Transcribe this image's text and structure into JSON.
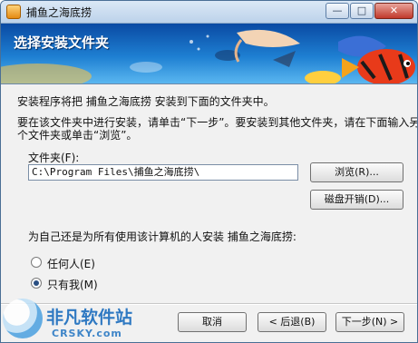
{
  "window": {
    "title": "捕鱼之海底捞",
    "min_glyph": "—",
    "max_glyph": "□",
    "close_glyph": "✕"
  },
  "banner": {
    "title": "选择安装文件夹"
  },
  "main": {
    "intro": "安装程序将把 捕鱼之海底捞 安装到下面的文件夹中。",
    "instructions_line1": "要在该文件夹中进行安装，请单击“下一步”。要安装到其他文件夹，请在下面输入另一",
    "instructions_line2": "个文件夹或单击“浏览”。",
    "folder_label": "文件夹(F):",
    "folder_value": "C:\\Program Files\\捕鱼之海底捞\\",
    "browse_button": "浏览(R)...",
    "disk_cost_button": "磁盘开销(D)...",
    "install_for_question": "为自己还是为所有使用该计算机的人安装 捕鱼之海底捞:",
    "radio_options": [
      {
        "label": "任何人(E)",
        "checked": false
      },
      {
        "label": "只有我(M)",
        "checked": true
      }
    ]
  },
  "footer": {
    "cancel_button": "取消",
    "back_button": "< 后退(B)",
    "next_button": "下一步(N) >"
  },
  "watermark": {
    "main": "非凡软件站",
    "sub": "CRSKY.com"
  },
  "colors": {
    "banner_top": "#0a4aa3",
    "banner_bottom": "#5ab7f0",
    "close_button": "#c1392b",
    "watermark": "#2f79c2"
  }
}
